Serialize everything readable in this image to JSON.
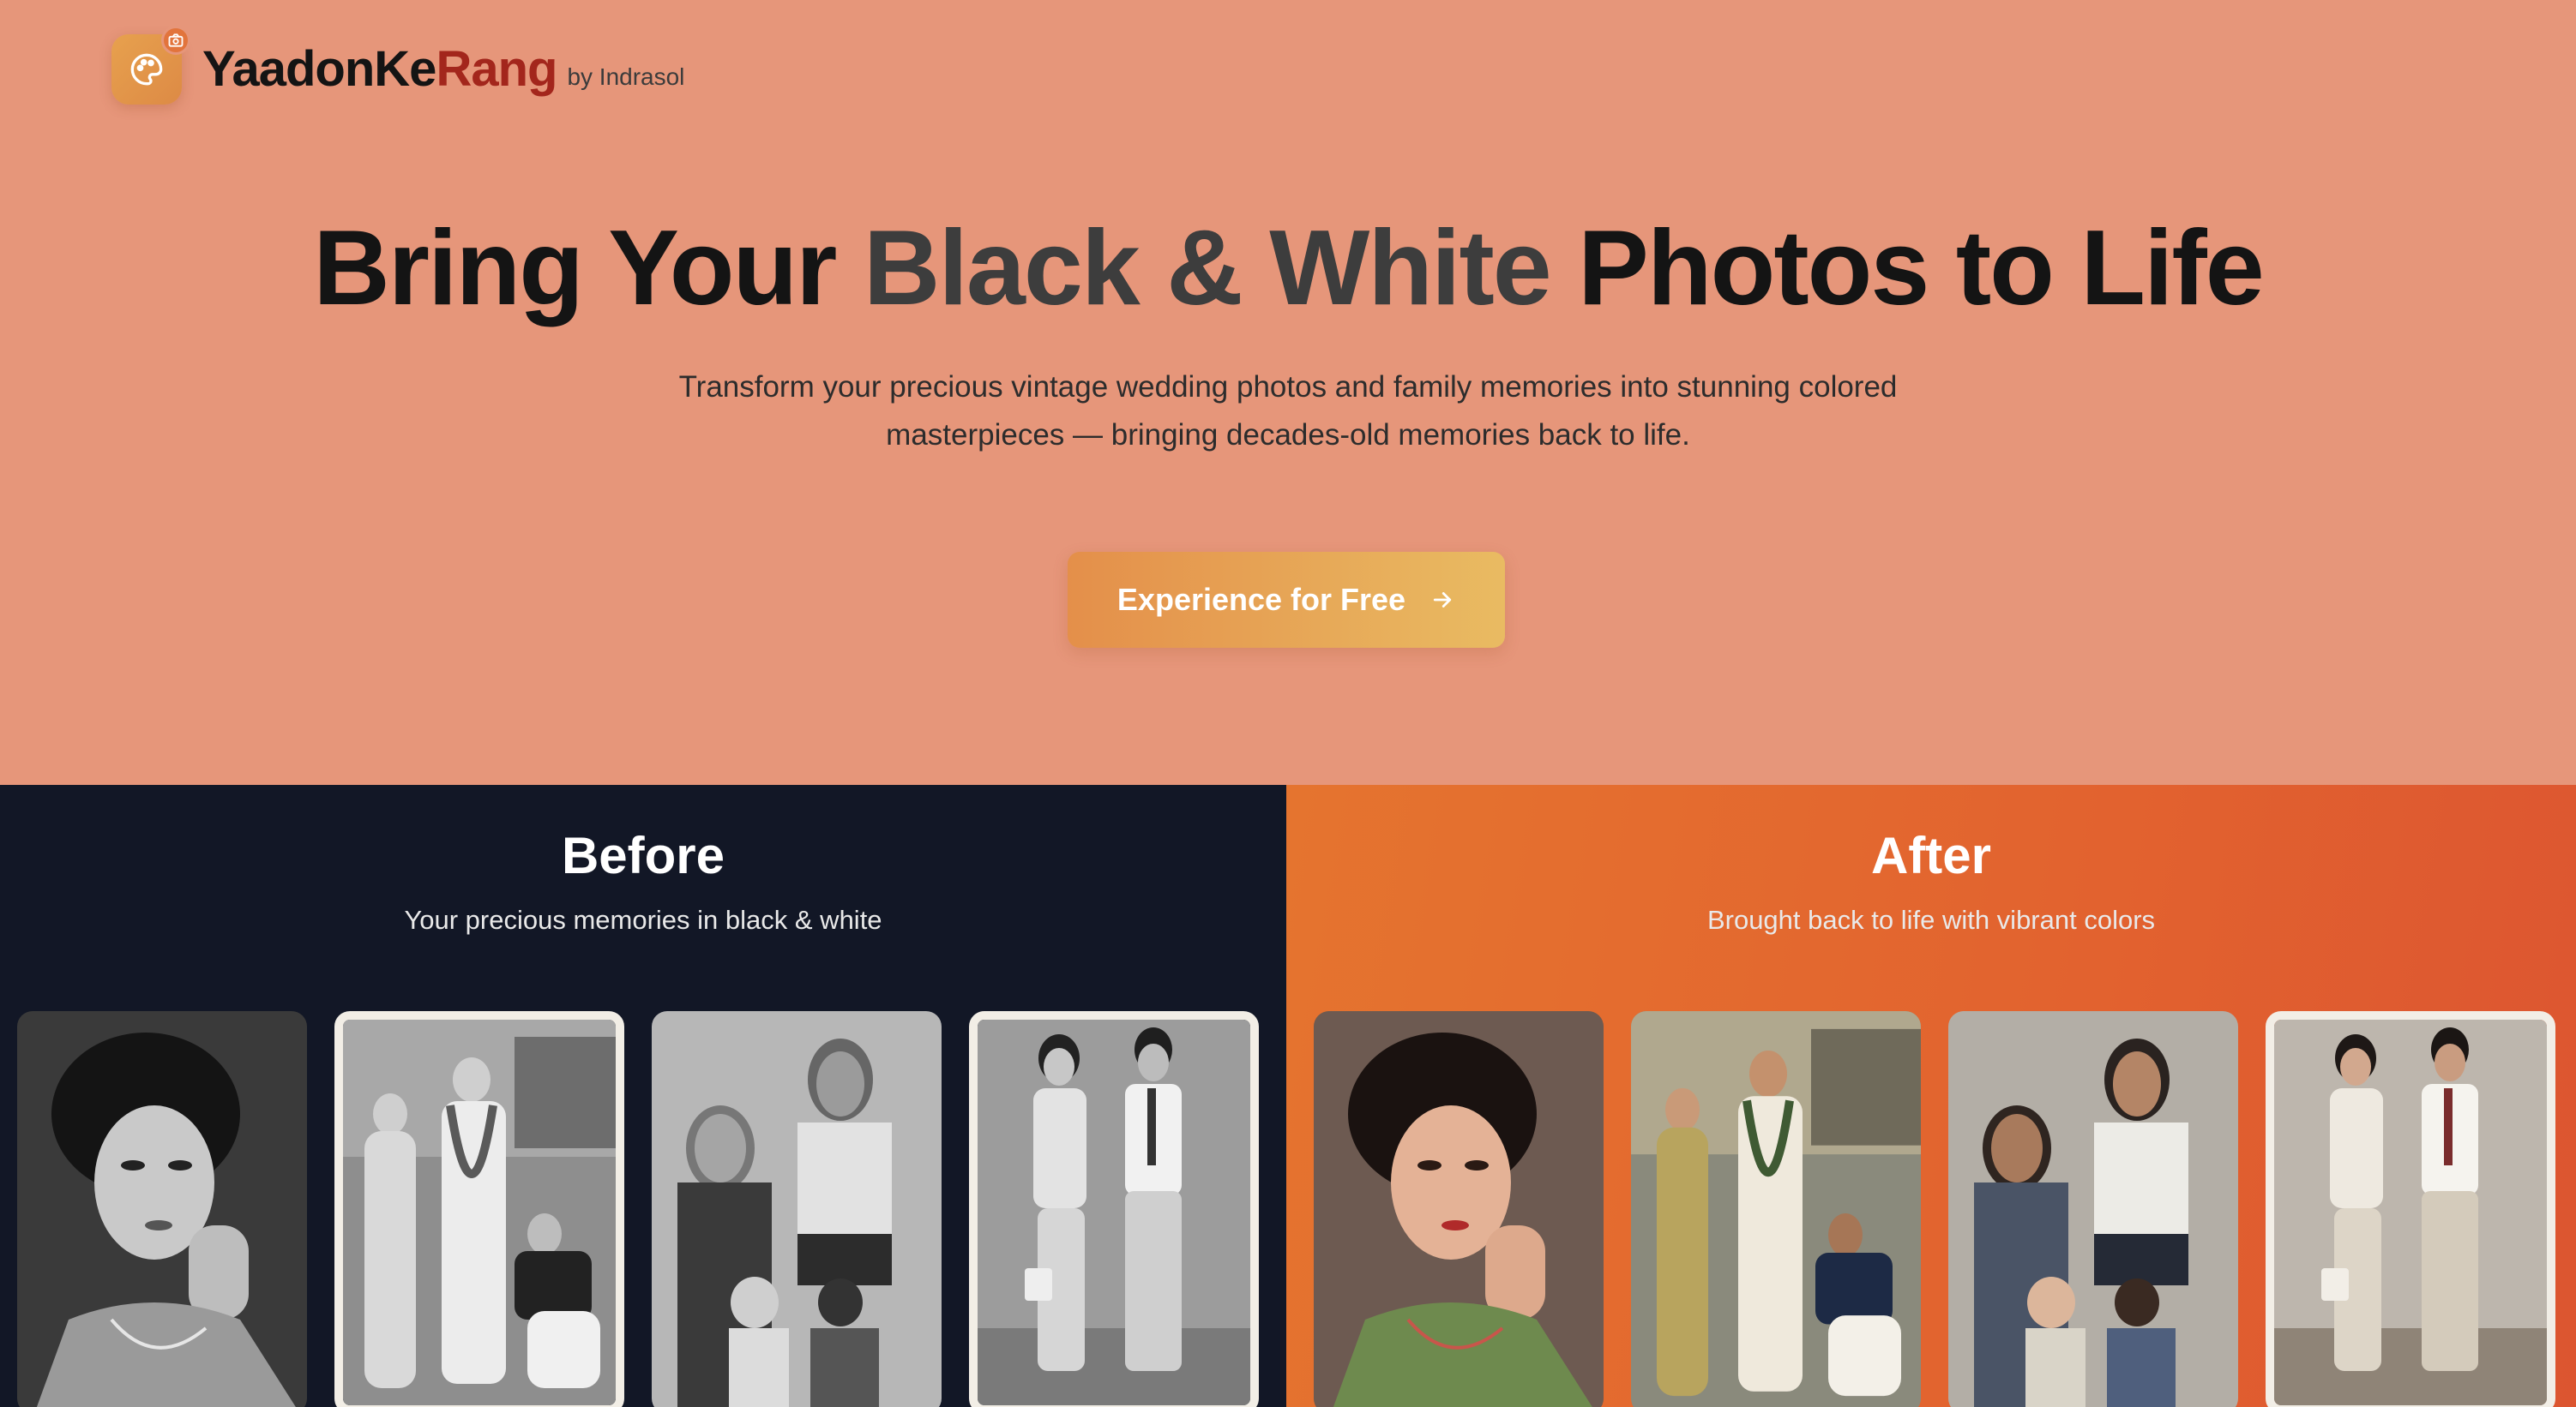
{
  "brand": {
    "name_part1": "YaadonKe",
    "name_part2": "Rang",
    "byline": "by Indrasol",
    "logo_icon": "palette-icon",
    "badge_icon": "camera-icon",
    "accent_color": "#a3261c"
  },
  "hero": {
    "headline_part1": "Bring Your ",
    "headline_highlight": "Black & White",
    "headline_part2": " Photos to Life",
    "subtext_line1": "Transform your precious vintage wedding photos and family memories into stunning colored",
    "subtext_line2": "masterpieces — bringing decades-old memories back to life.",
    "background_color": "#e6967a"
  },
  "cta": {
    "label": "Experience for Free",
    "icon": "arrow-right-icon",
    "gradient": [
      "#e48f4a",
      "#e9bb62"
    ]
  },
  "comparison": {
    "before": {
      "title": "Before",
      "subtitle": "Your precious memories in black & white",
      "background_color": "#121726",
      "photos": [
        "portrait-woman-bw",
        "wedding-group-bw",
        "family-mother-children-bw",
        "couple-standing-bw"
      ]
    },
    "after": {
      "title": "After",
      "subtitle": "Brought back to life with vibrant colors",
      "background_color": "#e5742f",
      "photos": [
        "portrait-woman-color",
        "wedding-group-color",
        "family-mother-children-color",
        "couple-standing-color"
      ]
    }
  }
}
